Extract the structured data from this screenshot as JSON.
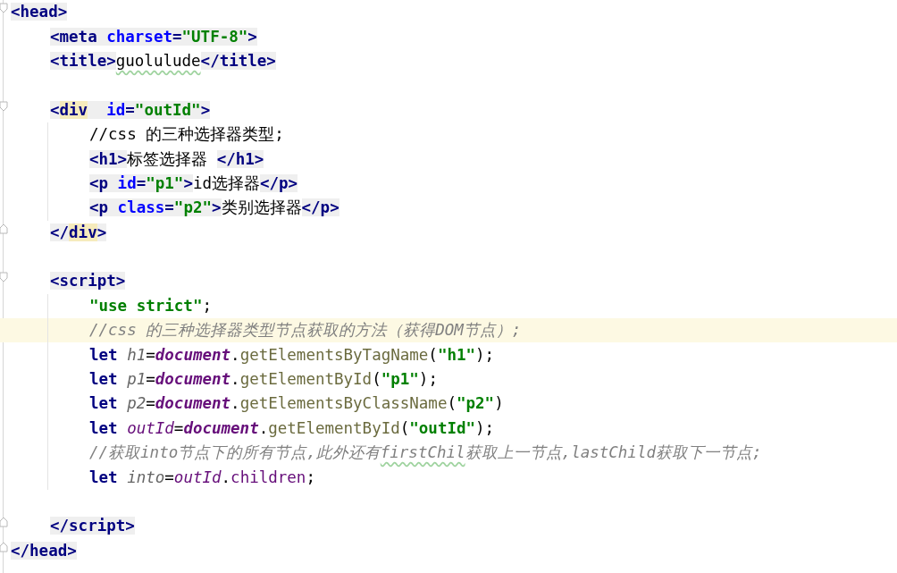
{
  "editor": {
    "lines": [
      {
        "kind": "fold-start",
        "current": false,
        "tokens": [
          {
            "kind": "tag",
            "text": "<head>"
          }
        ],
        "children": [
          {
            "kind": "code",
            "current": false,
            "tokens": [
              {
                "kind": "tag",
                "text": "<meta"
              },
              {
                "kind": "attr",
                "text": " charset"
              },
              {
                "kind": "tag",
                "text": "="
              },
              {
                "kind": "attr-value",
                "text": "\"UTF-8\""
              },
              {
                "kind": "tag",
                "text": ">"
              }
            ]
          },
          {
            "kind": "code",
            "current": false,
            "tokens": [
              {
                "kind": "tag",
                "text": "<title>"
              },
              {
                "kind": "text-typo",
                "text": "guolulude"
              },
              {
                "kind": "tag",
                "text": "</title>"
              }
            ]
          },
          {
            "kind": "blank",
            "current": false
          },
          {
            "kind": "fold-start",
            "current": false,
            "tokens": [
              {
                "kind": "tag",
                "text": "<"
              },
              {
                "kind": "tag-match",
                "text": "div"
              },
              {
                "kind": "attr",
                "text": "  id"
              },
              {
                "kind": "tag",
                "text": "="
              },
              {
                "kind": "attr-value",
                "text": "\"outId\""
              },
              {
                "kind": "tag",
                "text": ">"
              }
            ],
            "children": [
              {
                "kind": "code",
                "current": false,
                "tokens": [
                  {
                    "kind": "text",
                    "text": "//css 的三种选择器类型;"
                  }
                ]
              },
              {
                "kind": "code",
                "current": false,
                "tokens": [
                  {
                    "kind": "tag",
                    "text": "<h1>"
                  },
                  {
                    "kind": "text",
                    "text": "标签选择器 "
                  },
                  {
                    "kind": "tag",
                    "text": "</h1>"
                  }
                ]
              },
              {
                "kind": "code",
                "current": false,
                "tokens": [
                  {
                    "kind": "tag",
                    "text": "<p"
                  },
                  {
                    "kind": "attr",
                    "text": " id"
                  },
                  {
                    "kind": "tag",
                    "text": "="
                  },
                  {
                    "kind": "attr-value",
                    "text": "\"p1\""
                  },
                  {
                    "kind": "tag",
                    "text": ">"
                  },
                  {
                    "kind": "text",
                    "text": "id选择器"
                  },
                  {
                    "kind": "tag",
                    "text": "</p>"
                  }
                ]
              },
              {
                "kind": "code",
                "current": false,
                "tokens": [
                  {
                    "kind": "tag",
                    "text": "<p"
                  },
                  {
                    "kind": "attr",
                    "text": " class"
                  },
                  {
                    "kind": "tag",
                    "text": "="
                  },
                  {
                    "kind": "attr-value",
                    "text": "\"p2\""
                  },
                  {
                    "kind": "tag",
                    "text": ">"
                  },
                  {
                    "kind": "text",
                    "text": "类别选择器"
                  },
                  {
                    "kind": "tag",
                    "text": "</p>"
                  }
                ]
              }
            ]
          },
          {
            "kind": "fold-end",
            "current": false,
            "tokens": [
              {
                "kind": "tag",
                "text": "</"
              },
              {
                "kind": "tag-match",
                "text": "div"
              },
              {
                "kind": "tag",
                "text": ">"
              }
            ]
          },
          {
            "kind": "blank",
            "current": false
          },
          {
            "kind": "fold-start",
            "current": false,
            "tokens": [
              {
                "kind": "tag",
                "text": "<script>"
              }
            ],
            "children": [
              {
                "kind": "code",
                "current": false,
                "tokens": [
                  {
                    "kind": "string",
                    "text": "\"use strict\""
                  },
                  {
                    "kind": "punct",
                    "text": ";"
                  }
                ]
              },
              {
                "kind": "code",
                "current": true,
                "tokens": [
                  {
                    "kind": "comment",
                    "text": "//css 的三种选择器类型节点获取的方法（获得DOM节点）;"
                  }
                ]
              },
              {
                "kind": "code",
                "current": false,
                "tokens": [
                  {
                    "kind": "keyword",
                    "text": "let "
                  },
                  {
                    "kind": "local",
                    "text": "h1"
                  },
                  {
                    "kind": "punct",
                    "text": "="
                  },
                  {
                    "kind": "global",
                    "text": "document"
                  },
                  {
                    "kind": "punct",
                    "text": "."
                  },
                  {
                    "kind": "method",
                    "text": "getElementsByTagName"
                  },
                  {
                    "kind": "punct",
                    "text": "("
                  },
                  {
                    "kind": "string",
                    "text": "\"h1\""
                  },
                  {
                    "kind": "punct",
                    "text": ");"
                  }
                ]
              },
              {
                "kind": "code",
                "current": false,
                "tokens": [
                  {
                    "kind": "keyword",
                    "text": "let "
                  },
                  {
                    "kind": "local",
                    "text": "p1"
                  },
                  {
                    "kind": "punct",
                    "text": "="
                  },
                  {
                    "kind": "global",
                    "text": "document"
                  },
                  {
                    "kind": "punct",
                    "text": "."
                  },
                  {
                    "kind": "method",
                    "text": "getElementById"
                  },
                  {
                    "kind": "punct",
                    "text": "("
                  },
                  {
                    "kind": "string",
                    "text": "\"p1\""
                  },
                  {
                    "kind": "punct",
                    "text": ");"
                  }
                ]
              },
              {
                "kind": "code",
                "current": false,
                "tokens": [
                  {
                    "kind": "keyword",
                    "text": "let "
                  },
                  {
                    "kind": "local",
                    "text": "p2"
                  },
                  {
                    "kind": "punct",
                    "text": "="
                  },
                  {
                    "kind": "global",
                    "text": "document"
                  },
                  {
                    "kind": "punct",
                    "text": "."
                  },
                  {
                    "kind": "method",
                    "text": "getElementsByClassName"
                  },
                  {
                    "kind": "punct",
                    "text": "("
                  },
                  {
                    "kind": "string",
                    "text": "\"p2\""
                  },
                  {
                    "kind": "punct",
                    "text": ")"
                  }
                ]
              },
              {
                "kind": "code",
                "current": false,
                "tokens": [
                  {
                    "kind": "keyword",
                    "text": "let "
                  },
                  {
                    "kind": "used-var",
                    "text": "outId"
                  },
                  {
                    "kind": "punct",
                    "text": "="
                  },
                  {
                    "kind": "global",
                    "text": "document"
                  },
                  {
                    "kind": "punct",
                    "text": "."
                  },
                  {
                    "kind": "method",
                    "text": "getElementById"
                  },
                  {
                    "kind": "punct",
                    "text": "("
                  },
                  {
                    "kind": "string",
                    "text": "\"outId\""
                  },
                  {
                    "kind": "punct",
                    "text": ");"
                  }
                ]
              },
              {
                "kind": "code",
                "current": false,
                "tokens": [
                  {
                    "kind": "comment",
                    "text": "//获取into节点下的所有节点,此外还有"
                  },
                  {
                    "kind": "comment-typo",
                    "text": "firstChil"
                  },
                  {
                    "kind": "comment",
                    "text": "获取上一节点,lastChild获取下一节点;"
                  }
                ]
              },
              {
                "kind": "code",
                "current": false,
                "tokens": [
                  {
                    "kind": "keyword",
                    "text": "let "
                  },
                  {
                    "kind": "local",
                    "text": "into"
                  },
                  {
                    "kind": "punct",
                    "text": "="
                  },
                  {
                    "kind": "used-var",
                    "text": "outId"
                  },
                  {
                    "kind": "punct",
                    "text": "."
                  },
                  {
                    "kind": "property",
                    "text": "children"
                  },
                  {
                    "kind": "punct",
                    "text": ";"
                  }
                ]
              }
            ]
          },
          {
            "kind": "blank",
            "current": false
          },
          {
            "kind": "fold-end",
            "current": false,
            "tokens": [
              {
                "kind": "tag",
                "text": "</script>"
              }
            ]
          }
        ]
      },
      {
        "kind": "fold-end",
        "current": false,
        "tokens": [
          {
            "kind": "tag",
            "text": "</head>"
          }
        ]
      }
    ]
  }
}
